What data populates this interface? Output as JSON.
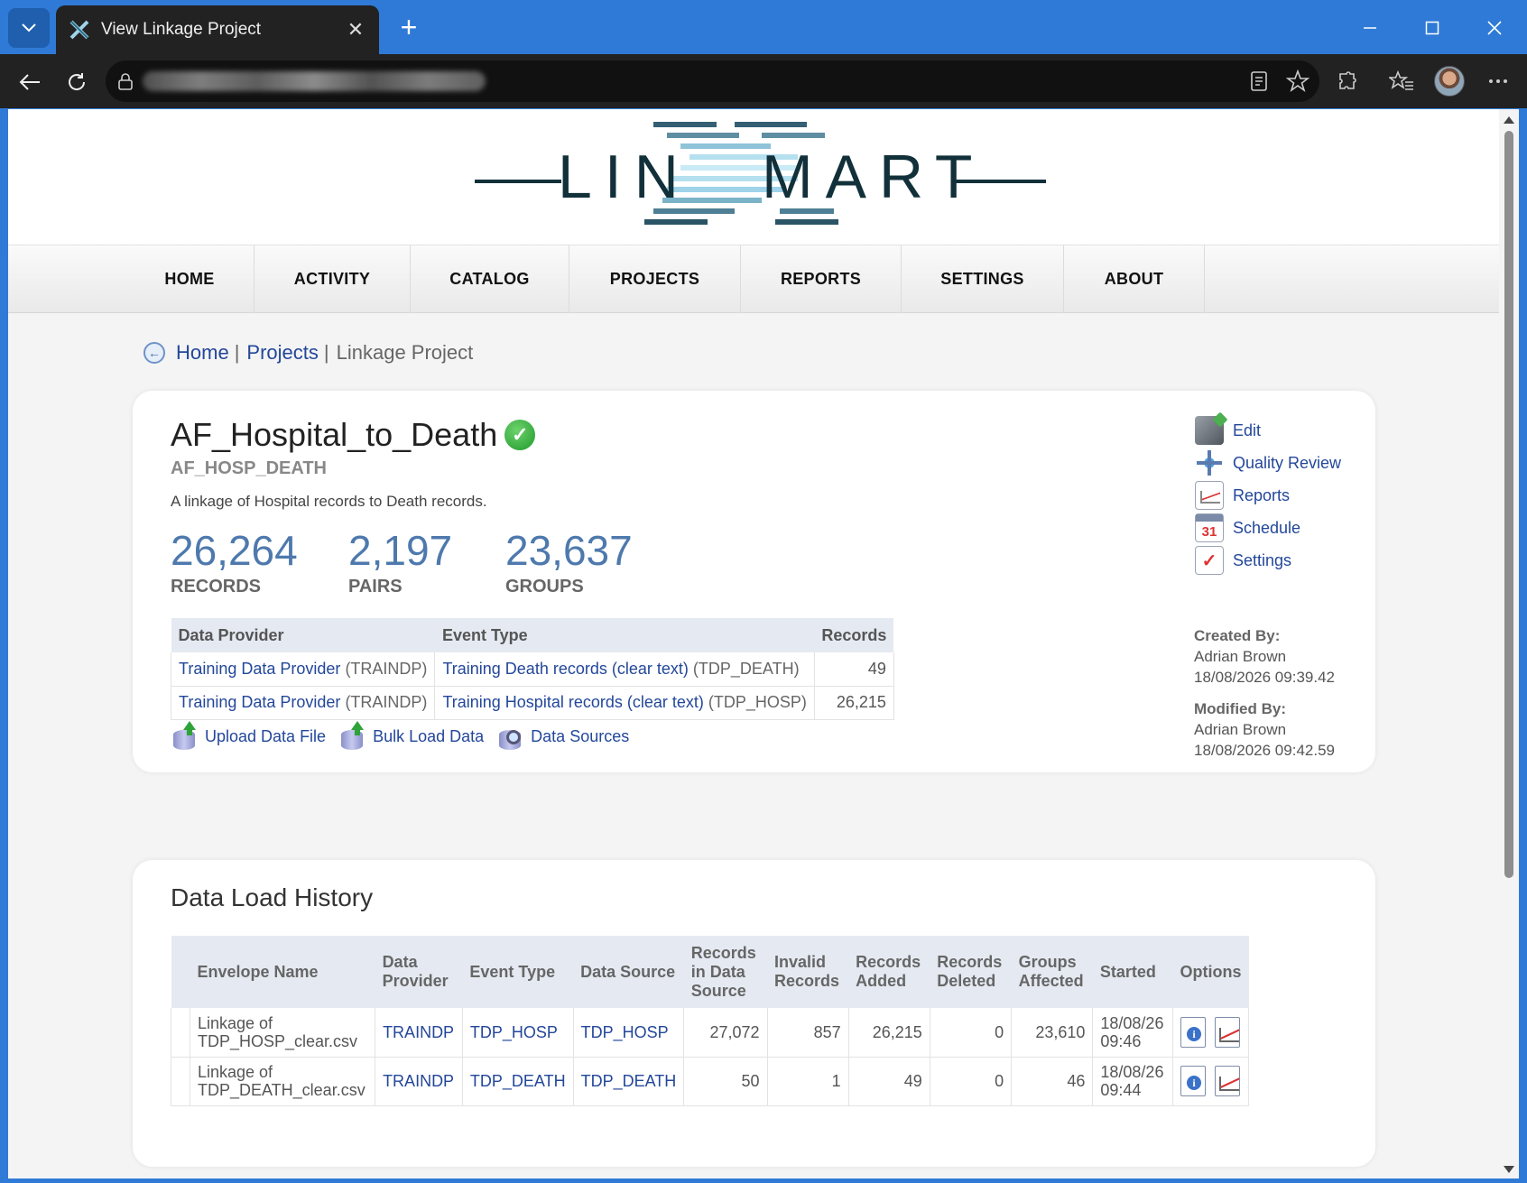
{
  "browser": {
    "tab_title": "View Linkage Project",
    "tab_close": "✕",
    "new_tab": "+"
  },
  "brand": {
    "logo_text_left": "LIN",
    "logo_text_right": "MART",
    "colors": {
      "logo_dark": "#12303a",
      "logo_light": "#9fd3ea",
      "link": "#23479a",
      "stat": "#4e79ad"
    }
  },
  "nav": {
    "items": [
      "HOME",
      "ACTIVITY",
      "CATALOG",
      "PROJECTS",
      "REPORTS",
      "SETTINGS",
      "ABOUT"
    ]
  },
  "breadcrumb": {
    "back_icon": "back-arrow-icon",
    "home": "Home",
    "projects": "Projects",
    "current": "Linkage Project",
    "sep": "|"
  },
  "project": {
    "name": "AF_Hospital_to_Death",
    "code": "AF_HOSP_DEATH",
    "description": "A linkage of Hospital records to Death records.",
    "status_icon": "check-icon",
    "stats": [
      {
        "value": "26,264",
        "label": "RECORDS"
      },
      {
        "value": "2,197",
        "label": "PAIRS"
      },
      {
        "value": "23,637",
        "label": "GROUPS"
      }
    ],
    "providers_table": {
      "headers": [
        "Data Provider",
        "Event Type",
        "Records"
      ],
      "rows": [
        {
          "provider": "Training Data Provider",
          "provider_code": "(TRAINDP)",
          "event": "Training Death records (clear text)",
          "event_code": "(TDP_DEATH)",
          "records": "49"
        },
        {
          "provider": "Training Data Provider",
          "provider_code": "(TRAINDP)",
          "event": "Training Hospital records (clear text)",
          "event_code": "(TDP_HOSP)",
          "records": "26,215"
        }
      ]
    },
    "actions": [
      "Upload Data File",
      "Bulk Load Data",
      "Data Sources"
    ],
    "side_links": [
      "Edit",
      "Quality Review",
      "Reports",
      "Schedule",
      "Settings"
    ],
    "calendar_day": "31",
    "settings_mark": "✓",
    "created_label": "Created By:",
    "created_by": "Adrian Brown",
    "created_at": "18/08/2026 09:39.42",
    "modified_label": "Modified By:",
    "modified_by": "Adrian Brown",
    "modified_at": "18/08/2026 09:42.59"
  },
  "history": {
    "title": "Data Load History",
    "headers": {
      "envelope": "Envelope Name",
      "provider": "Data Provider",
      "event": "Event Type",
      "source": "Data Source",
      "in_source": "Records in Data Source",
      "invalid": "Invalid Records",
      "added": "Records Added",
      "deleted": "Records Deleted",
      "groups": "Groups Affected",
      "started": "Started",
      "options": "Options"
    },
    "rows": [
      {
        "envelope": "Linkage of TDP_HOSP_clear.csv",
        "provider": "TRAINDP",
        "event": "TDP_HOSP",
        "source": "TDP_HOSP",
        "in_source": "27,072",
        "invalid": "857",
        "added": "26,215",
        "deleted": "0",
        "groups": "23,610",
        "started": "18/08/26 09:46"
      },
      {
        "envelope": "Linkage of TDP_DEATH_clear.csv",
        "provider": "TRAINDP",
        "event": "TDP_DEATH",
        "source": "TDP_DEATH",
        "in_source": "50",
        "invalid": "1",
        "added": "49",
        "deleted": "0",
        "groups": "46",
        "started": "18/08/26 09:44"
      }
    ]
  }
}
